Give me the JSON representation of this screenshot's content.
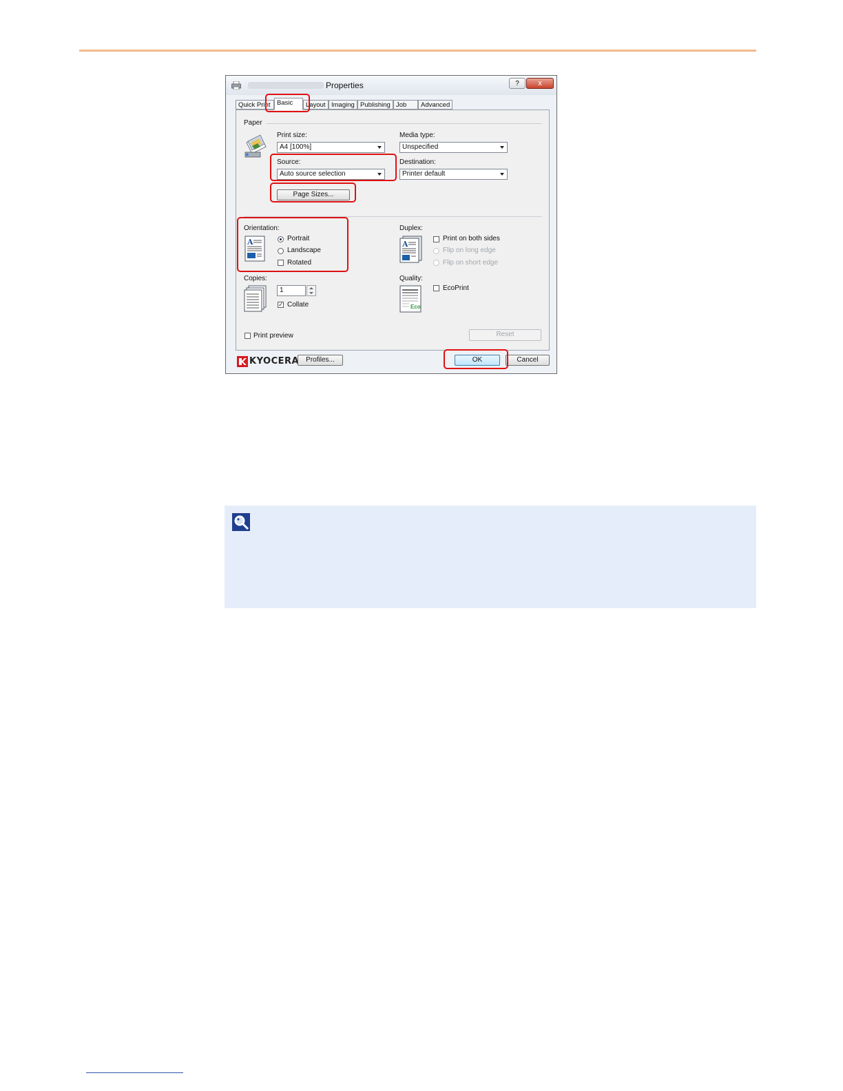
{
  "dialog": {
    "title": "Properties",
    "help_label": "?",
    "close_label": "x",
    "tabs": [
      "Quick Print",
      "Basic",
      "Layout",
      "Imaging",
      "Publishing",
      "Job",
      "Advanced"
    ],
    "active_tab": "Basic",
    "paper": {
      "group_label": "Paper",
      "print_size_label": "Print size:",
      "print_size_value": "A4  [100%]",
      "media_type_label": "Media type:",
      "media_type_value": "Unspecified",
      "source_label": "Source:",
      "source_value": "Auto source selection",
      "destination_label": "Destination:",
      "destination_value": "Printer default",
      "page_sizes_button": "Page Sizes..."
    },
    "orientation": {
      "label": "Orientation:",
      "options": [
        "Portrait",
        "Landscape"
      ],
      "selected": "Portrait",
      "rotated_label": "Rotated",
      "rotated_checked": false
    },
    "duplex": {
      "label": "Duplex:",
      "both_sides_label": "Print on both sides",
      "both_sides_checked": false,
      "long_edge_label": "Flip on long edge",
      "short_edge_label": "Flip on short edge"
    },
    "copies": {
      "label": "Copies:",
      "value": "1",
      "collate_label": "Collate",
      "collate_checked": true
    },
    "quality": {
      "label": "Quality:",
      "ecoprint_label": "EcoPrint",
      "ecoprint_checked": false,
      "eco_badge": "Eco"
    },
    "print_preview_label": "Print preview",
    "reset_button": "Reset",
    "footer": {
      "brand": "KYOCERA",
      "profiles_button": "Profiles...",
      "ok_button": "OK",
      "cancel_button": "Cancel"
    }
  },
  "colors": {
    "highlight": "#e01010",
    "top_rule": "#f5b98c",
    "note_background": "#e6edfa",
    "brand_red": "#d71920"
  },
  "icons": [
    "printer-icon",
    "paper-stack-icon",
    "portrait-document-icon",
    "duplex-document-icon",
    "copies-stack-icon",
    "ecoprint-document-icon",
    "kyocera-logo-icon",
    "note-magnifier-icon"
  ]
}
